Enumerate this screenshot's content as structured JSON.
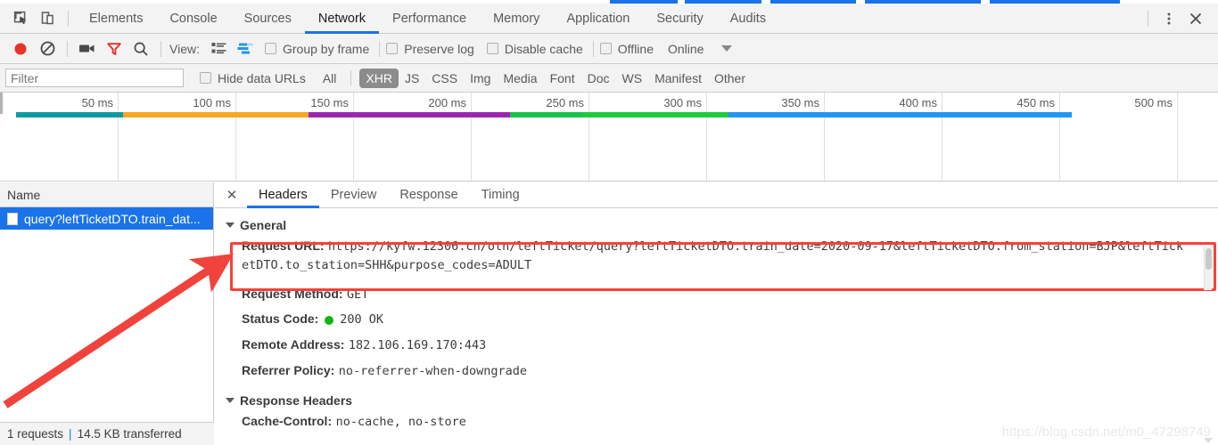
{
  "window": {
    "accent_blue": "#1a73e8",
    "toolbar_bg": "#f3f3f3",
    "more_options_icon": "kebab-menu-icon",
    "close_icon": "close-icon"
  },
  "devtools_tabs": {
    "inspect_icon": "inspect-element-icon",
    "device_icon": "toggle-device-toolbar-icon",
    "items": [
      {
        "label": "Elements",
        "active": false
      },
      {
        "label": "Console",
        "active": false
      },
      {
        "label": "Sources",
        "active": false
      },
      {
        "label": "Network",
        "active": true
      },
      {
        "label": "Performance",
        "active": false
      },
      {
        "label": "Memory",
        "active": false
      },
      {
        "label": "Application",
        "active": false
      },
      {
        "label": "Security",
        "active": false
      },
      {
        "label": "Audits",
        "active": false
      }
    ]
  },
  "network_toolbar": {
    "record_icon": "record-button-icon",
    "clear_icon": "clear-icon",
    "capture_screenshots_icon": "camera-icon",
    "filter_icon": "filter-funnel-icon",
    "search_icon": "search-icon",
    "view_label": "View:",
    "list_view_icon": "list-view-icon",
    "waterfall_view_icon": "waterfall-view-icon",
    "checkboxes": [
      {
        "label": "Group by frame",
        "checked": false
      },
      {
        "label": "Preserve log",
        "checked": false
      },
      {
        "label": "Disable cache",
        "checked": false
      },
      {
        "label": "Offline",
        "checked": false
      }
    ],
    "throttling_value": "Online",
    "throttling_caret_icon": "chevron-down-icon"
  },
  "filter_bar": {
    "placeholder": "Filter",
    "value": "",
    "hide_data_urls": {
      "label": "Hide data URLs",
      "checked": false
    },
    "types": [
      {
        "label": "All",
        "active": false
      },
      {
        "label": "XHR",
        "active": true
      },
      {
        "label": "JS",
        "active": false
      },
      {
        "label": "CSS",
        "active": false
      },
      {
        "label": "Img",
        "active": false
      },
      {
        "label": "Media",
        "active": false
      },
      {
        "label": "Font",
        "active": false
      },
      {
        "label": "Doc",
        "active": false
      },
      {
        "label": "WS",
        "active": false
      },
      {
        "label": "Manifest",
        "active": false
      },
      {
        "label": "Other",
        "active": false
      }
    ]
  },
  "overview_timeline": {
    "ticks": [
      "50 ms",
      "100 ms",
      "150 ms",
      "200 ms",
      "250 ms",
      "300 ms",
      "350 ms",
      "400 ms",
      "450 ms",
      "500 ms"
    ],
    "bands": [
      {
        "name": "queueing",
        "color": "#0f9aa0",
        "left_pct": 1.3,
        "width_pct": 8.8
      },
      {
        "name": "stalled",
        "color": "#f5a623",
        "left_pct": 10.1,
        "width_pct": 15.2
      },
      {
        "name": "ssl",
        "color": "#9b27b0",
        "left_pct": 25.3,
        "width_pct": 16.6
      },
      {
        "name": "request-sent",
        "color": "#19c24a",
        "left_pct": 41.9,
        "width_pct": 6.0
      },
      {
        "name": "waiting-ttfb",
        "color": "#1eca3e",
        "left_pct": 47.9,
        "width_pct": 11.9
      },
      {
        "name": "content-download",
        "color": "#2196f3",
        "left_pct": 59.8,
        "width_pct": 28.2
      }
    ]
  },
  "request_list": {
    "column_header": "Name",
    "rows": [
      {
        "icon": "xhr-document-icon",
        "name": "query?leftTicketDTO.train_dat...",
        "selected": true
      }
    ],
    "status": {
      "requests": "1 requests",
      "divider": "|",
      "transferred": "14.5 KB transferred"
    }
  },
  "detail_panel": {
    "close_icon": "close-icon",
    "tabs": [
      {
        "label": "Headers",
        "active": true
      },
      {
        "label": "Preview",
        "active": false
      },
      {
        "label": "Response",
        "active": false
      },
      {
        "label": "Timing",
        "active": false
      }
    ],
    "general": {
      "section_title": "General",
      "collapse_icon": "triangle-down-icon",
      "request_url_key": "Request URL:",
      "request_url_value": "https://kyfw.12306.cn/otn/leftTicket/query?leftTicketDTO.train_date=2020-09-17&leftTicketDTO.from_station=BJP&leftTicketDTO.to_station=SHH&purpose_codes=ADULT",
      "request_method_key": "Request Method:",
      "request_method_value": "GET",
      "status_code_key": "Status Code:",
      "status_code_value": "200 OK",
      "status_dot_color": "#12b412",
      "remote_address_key": "Remote Address:",
      "remote_address_value": "182.106.169.170:443",
      "referrer_policy_key": "Referrer Policy:",
      "referrer_policy_value": "no-referrer-when-downgrade"
    },
    "response_headers": {
      "section_title": "Response Headers",
      "collapse_icon": "triangle-down-icon",
      "rows": [
        {
          "key": "Cache-Control:",
          "value": "no-cache, no-store"
        }
      ]
    }
  },
  "annotations": {
    "highlight_box_color": "#f7413a",
    "arrow_color": "#f0433c",
    "arrow_label": "red-arrow-pointing-to-request-url"
  },
  "watermark": {
    "text": "https://blog.csdn.net/m0_47298749"
  }
}
